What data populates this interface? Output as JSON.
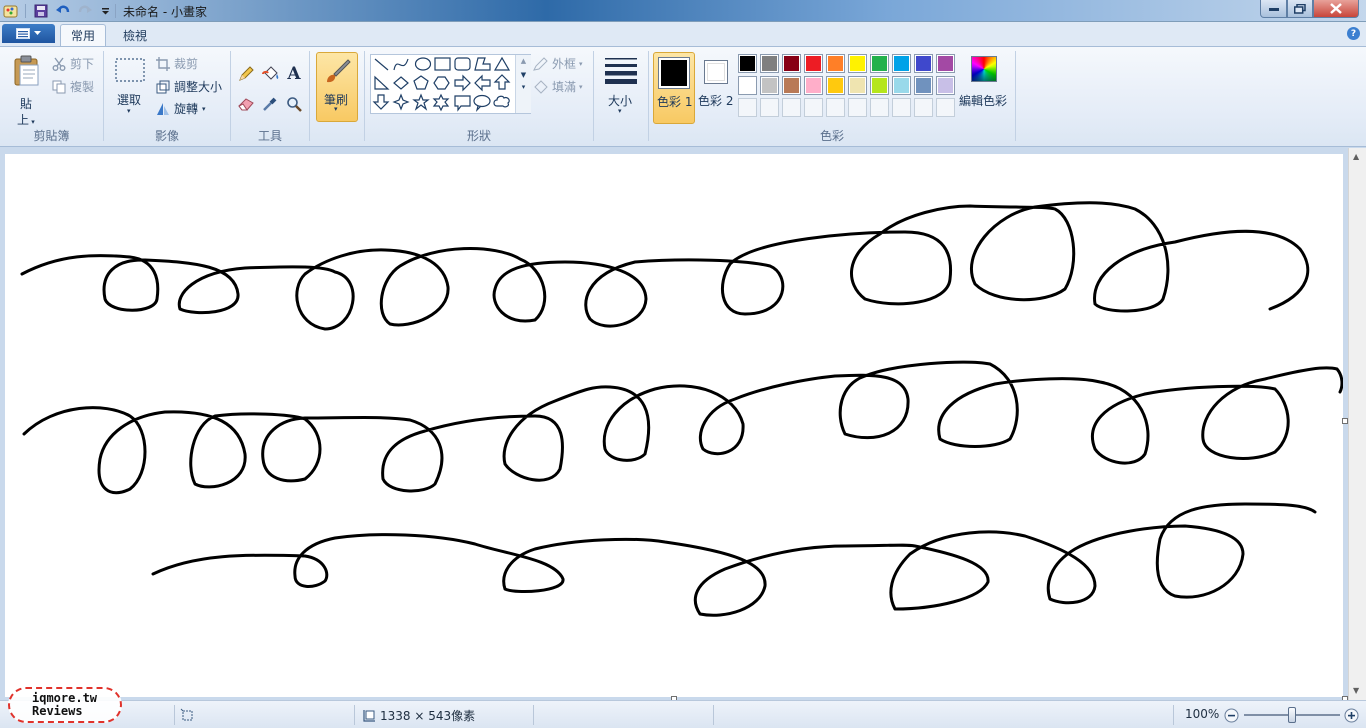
{
  "window": {
    "title": "未命名 - 小畫家"
  },
  "tabs": {
    "home": "常用",
    "view": "檢視"
  },
  "clipboard": {
    "paste": "貼",
    "paste2": "上",
    "cut": "剪下",
    "copy": "複製",
    "label": "剪貼簿"
  },
  "image": {
    "select": "選取",
    "crop": "裁剪",
    "resize": "調整大小",
    "rotate": "旋轉",
    "label": "影像"
  },
  "tools": {
    "label": "工具"
  },
  "brushes": {
    "label": "筆刷"
  },
  "shapes": {
    "outline": "外框",
    "fill": "填滿",
    "label": "形狀"
  },
  "size": {
    "label": "大小"
  },
  "colors": {
    "color1": "色彩 1",
    "color2": "色彩 2",
    "edit": "編輯色彩",
    "label": "色彩",
    "color1_value": "#000000",
    "color2_value": "#ffffff",
    "palette_row1": [
      "#000000",
      "#7f7f7f",
      "#880015",
      "#ed1c24",
      "#ff7f27",
      "#fff200",
      "#22b14c",
      "#00a2e8",
      "#3f48cc",
      "#a349a4"
    ],
    "palette_row2": [
      "#ffffff",
      "#c3c3c3",
      "#b97a57",
      "#ffaec9",
      "#ffc90e",
      "#efe4b0",
      "#b5e61d",
      "#99d9ea",
      "#7092be",
      "#c8bfe7"
    ]
  },
  "status": {
    "dimensions": "1338 × 543像素",
    "zoom": "100%"
  },
  "watermark": {
    "line1": "iqmore.tw",
    "line2": "Reviews"
  }
}
